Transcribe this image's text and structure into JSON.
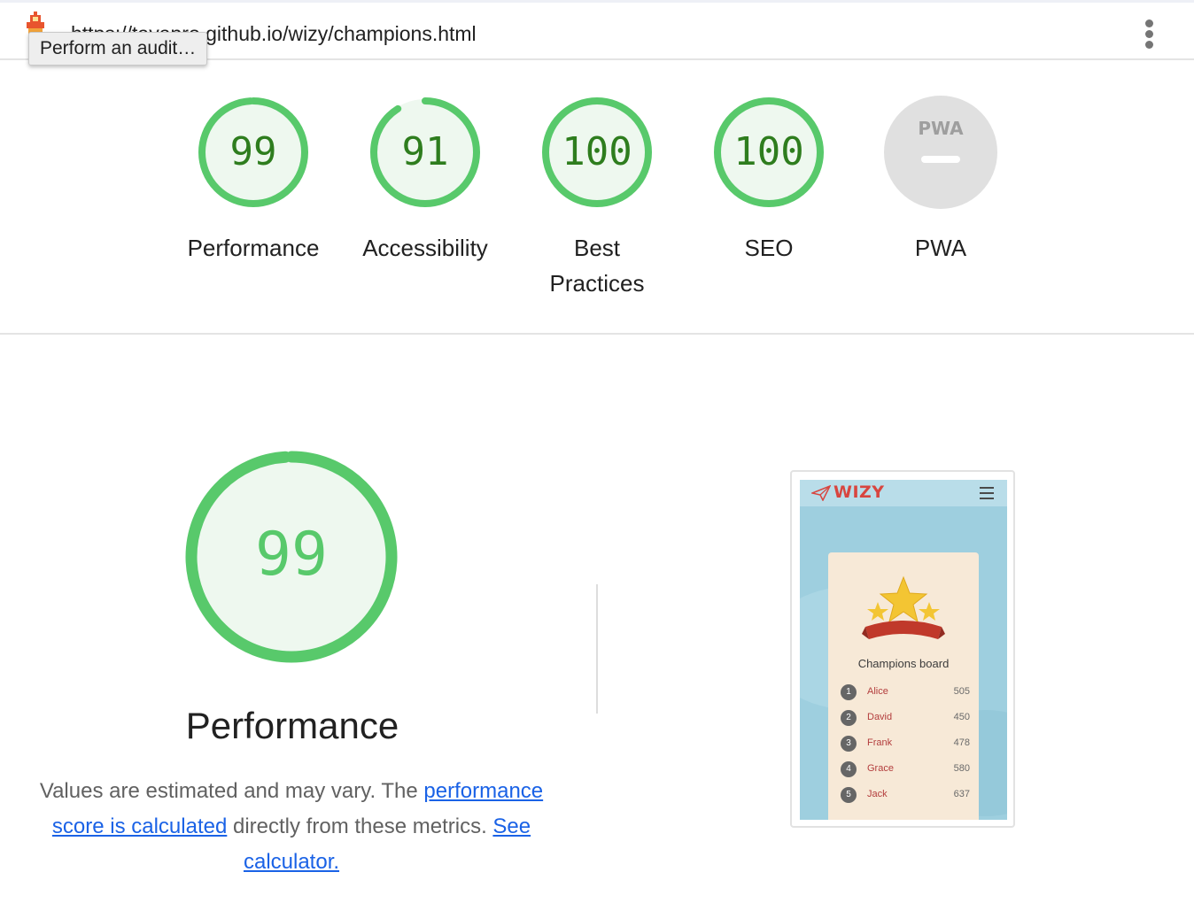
{
  "topbar": {
    "url": "https://tayapro.github.io/wizy/champions.html",
    "tooltip": "Perform an audit…",
    "logo_icon": "lighthouse-icon",
    "menu_icon": "more-vert-icon"
  },
  "categories": [
    {
      "label": "Performance",
      "score": "99",
      "fraction": 0.99,
      "status": "pass"
    },
    {
      "label": "Accessibility",
      "score": "91",
      "fraction": 0.91,
      "status": "pass"
    },
    {
      "label": "Best Practices",
      "score": "100",
      "fraction": 1.0,
      "status": "pass"
    },
    {
      "label": "SEO",
      "score": "100",
      "fraction": 1.0,
      "status": "pass"
    },
    {
      "label": "PWA",
      "badge": "PWA",
      "status": "na"
    }
  ],
  "summary": {
    "score": "99",
    "fraction": 0.99,
    "title": "Performance",
    "desc_1": "Values are estimated and may vary. The ",
    "link_1": "performance score is calculated",
    "desc_2": " directly from these metrics. ",
    "link_2": "See calculator."
  },
  "colors": {
    "pass": "#0cce6b",
    "pass_ring": "#58c96b",
    "pass_fill": "#eef8ef",
    "pass_text": "#2e7d1e",
    "na_fill": "#e0e0e0",
    "link": "#1a62e6"
  },
  "screenshot": {
    "brand": "WIZY",
    "board_title": "Champions board",
    "icons": [
      "paper-plane-icon",
      "hamburger-menu-icon",
      "star-trophy-icon"
    ],
    "rows": [
      {
        "rank": "1",
        "name": "Alice",
        "score": "505"
      },
      {
        "rank": "2",
        "name": "David",
        "score": "450"
      },
      {
        "rank": "3",
        "name": "Frank",
        "score": "478"
      },
      {
        "rank": "4",
        "name": "Grace",
        "score": "580"
      },
      {
        "rank": "5",
        "name": "Jack",
        "score": "637"
      }
    ]
  }
}
